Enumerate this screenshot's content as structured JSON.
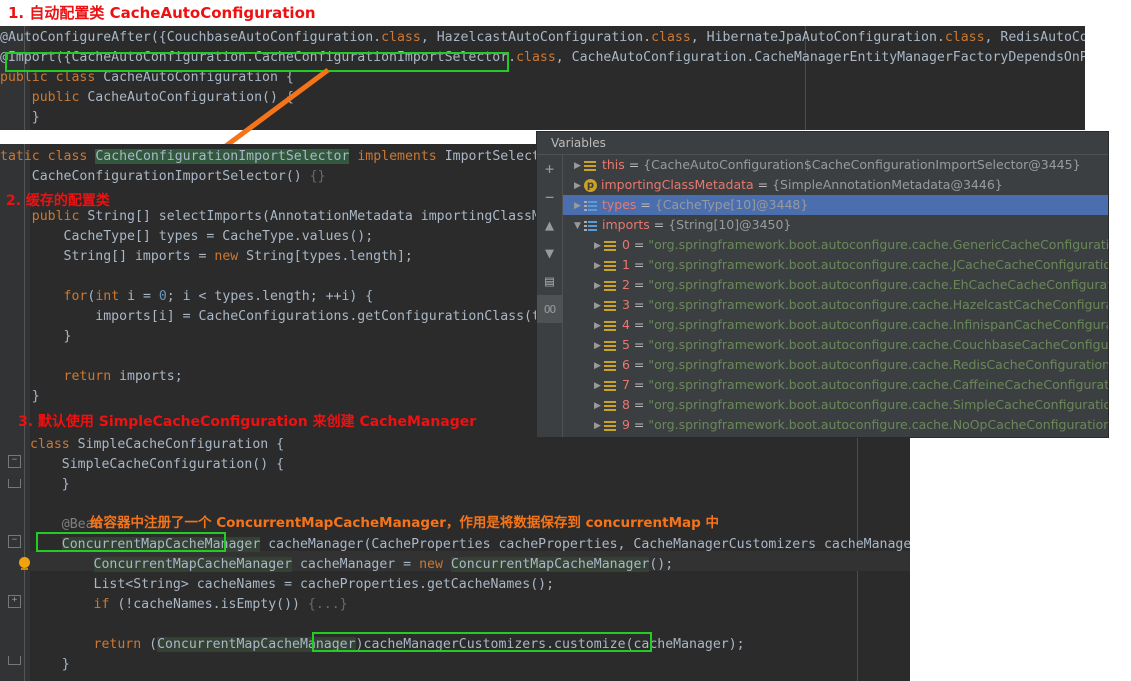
{
  "page": {
    "title_annotation": "1. 自动配置类 CacheAutoConfiguration"
  },
  "annotations": [
    {
      "id": "a1",
      "text": "1. 自动配置类 CacheAutoConfiguration",
      "color": "#ee1111"
    },
    {
      "id": "a2",
      "text": "2. 缓存的配置类",
      "color": "#ee1111"
    },
    {
      "id": "a3",
      "text": "3. 默认使用 SimpleCacheConfiguration 来创建 CacheManager",
      "color": "#ee1111"
    },
    {
      "id": "a4",
      "text": "给容器中注册了一个 ConcurrentMapCacheManager，作用是将数据保存到 concurrentMap 中",
      "color": "#f5741a"
    }
  ],
  "editor_top": {
    "lines": [
      {
        "parts": [
          {
            "t": "@AutoConfigureAfter({CouchbaseAutoConfiguration.",
            "c": "plain"
          },
          {
            "t": "class",
            "c": "kw"
          },
          {
            "t": ", HazelcastAutoConfiguration.",
            "c": "plain"
          },
          {
            "t": "class",
            "c": "kw"
          },
          {
            "t": ", HibernateJpaAutoConfiguration.",
            "c": "plain"
          },
          {
            "t": "class",
            "c": "kw"
          },
          {
            "t": ", RedisAutoConfiguration.cl",
            "c": "plain"
          }
        ]
      },
      {
        "parts": [
          {
            "t": "@Import({CacheAutoConfiguration.CacheConfigurationImportSelector.",
            "c": "plain"
          },
          {
            "t": "class",
            "c": "kw"
          },
          {
            "t": ", CacheAutoConfiguration.CacheManagerEntityManagerFactoryDependsOnPostProcessor.c",
            "c": "plain"
          }
        ]
      },
      {
        "parts": [
          {
            "t": "public",
            "c": "kw"
          },
          {
            "t": " ",
            "c": "plain"
          },
          {
            "t": "class",
            "c": "kw"
          },
          {
            "t": " CacheAutoConfiguration {",
            "c": "plain"
          }
        ]
      },
      {
        "parts": [
          {
            "t": "    ",
            "c": "plain"
          },
          {
            "t": "public",
            "c": "kw"
          },
          {
            "t": " CacheAutoConfiguration() {",
            "c": "plain"
          }
        ]
      },
      {
        "parts": [
          {
            "t": "    }",
            "c": "plain"
          }
        ]
      }
    ]
  },
  "editor_mid": {
    "lines": [
      {
        "parts": [
          {
            "t": "tatic",
            "c": "kw"
          },
          {
            "t": " ",
            "c": "plain"
          },
          {
            "t": "class",
            "c": "kw"
          },
          {
            "t": " ",
            "c": "plain"
          },
          {
            "t": "CacheConfigurationImportSelector",
            "c": "sel"
          },
          {
            "t": " ",
            "c": "plain"
          },
          {
            "t": "implements",
            "c": "kw"
          },
          {
            "t": " ImportSelector {",
            "c": "plain"
          }
        ]
      },
      {
        "parts": [
          {
            "t": "    CacheConfigurationImportSelector() ",
            "c": "plain"
          },
          {
            "t": "{}",
            "c": "grey"
          }
        ]
      },
      {
        "parts": [
          {
            "t": "",
            "c": "plain"
          }
        ]
      },
      {
        "parts": [
          {
            "t": "    ",
            "c": "plain"
          },
          {
            "t": "public",
            "c": "kw"
          },
          {
            "t": " String[] selectImports(AnnotationMetadata importingClassMetadata)",
            "c": "plain"
          }
        ]
      },
      {
        "parts": [
          {
            "t": "        CacheType[] types = CacheType.values();",
            "c": "plain"
          }
        ]
      },
      {
        "parts": [
          {
            "t": "        String[] imports = ",
            "c": "plain"
          },
          {
            "t": "new",
            "c": "kw"
          },
          {
            "t": " String[types.length];",
            "c": "plain"
          }
        ]
      },
      {
        "parts": [
          {
            "t": "",
            "c": "plain"
          }
        ]
      },
      {
        "parts": [
          {
            "t": "        ",
            "c": "plain"
          },
          {
            "t": "for",
            "c": "kw"
          },
          {
            "t": "(",
            "c": "plain"
          },
          {
            "t": "int",
            "c": "kw"
          },
          {
            "t": " i = ",
            "c": "plain"
          },
          {
            "t": "0",
            "c": "num"
          },
          {
            "t": "; i < types.length; ++i) {",
            "c": "plain"
          }
        ]
      },
      {
        "parts": [
          {
            "t": "            imports[i] = CacheConfigurations.getConfigurationClass(types[i]);",
            "c": "plain"
          }
        ]
      },
      {
        "parts": [
          {
            "t": "        }",
            "c": "plain"
          }
        ]
      },
      {
        "parts": [
          {
            "t": "",
            "c": "plain"
          }
        ]
      },
      {
        "parts": [
          {
            "t": "        ",
            "c": "plain"
          },
          {
            "t": "return",
            "c": "kw"
          },
          {
            "t": " imports;",
            "c": "plain"
          }
        ]
      },
      {
        "parts": [
          {
            "t": "    }",
            "c": "plain"
          }
        ]
      }
    ]
  },
  "editor_bottom": {
    "lines": [
      {
        "parts": [
          {
            "t": "class",
            "c": "kw"
          },
          {
            "t": " SimpleCacheConfiguration {",
            "c": "plain"
          }
        ]
      },
      {
        "parts": [
          {
            "t": "    SimpleCacheConfiguration() {",
            "c": "plain"
          }
        ]
      },
      {
        "parts": [
          {
            "t": "    }",
            "c": "plain"
          }
        ]
      },
      {
        "parts": [
          {
            "t": "",
            "c": "plain"
          }
        ]
      },
      {
        "parts": [
          {
            "t": "    ",
            "c": "plain"
          },
          {
            "t": "@Bean",
            "c": "cmt"
          }
        ]
      },
      {
        "parts": [
          {
            "t": "    ",
            "c": "plain"
          },
          {
            "t": "ConcurrentMapCacheManager",
            "c": "selm"
          },
          {
            "t": " cacheManager(CacheProperties cacheProperties, CacheManagerCustomizers cacheManagerCustomizers) {",
            "c": "plain"
          }
        ]
      },
      {
        "parts": [
          {
            "t": "        ",
            "c": "plain"
          },
          {
            "t": "ConcurrentMapCacheManager",
            "c": "selm"
          },
          {
            "t": " cacheManager = ",
            "c": "plain"
          },
          {
            "t": "new",
            "c": "kw"
          },
          {
            "t": " ",
            "c": "plain"
          },
          {
            "t": "ConcurrentMapCacheManager",
            "c": "selm"
          },
          {
            "t": "();",
            "c": "plain"
          }
        ]
      },
      {
        "parts": [
          {
            "t": "        List<String> cacheNames = cacheProperties.getCacheNames();",
            "c": "plain"
          }
        ]
      },
      {
        "parts": [
          {
            "t": "        ",
            "c": "plain"
          },
          {
            "t": "if",
            "c": "kw"
          },
          {
            "t": " (!cacheNames.isEmpty()) ",
            "c": "plain"
          },
          {
            "t": "{...}",
            "c": "grey"
          }
        ]
      },
      {
        "parts": [
          {
            "t": "",
            "c": "plain"
          }
        ]
      },
      {
        "parts": [
          {
            "t": "        ",
            "c": "plain"
          },
          {
            "t": "return",
            "c": "kw"
          },
          {
            "t": " (",
            "c": "plain"
          },
          {
            "t": "ConcurrentMapCacheManager",
            "c": "selm"
          },
          {
            "t": ")cacheManagerCustomizers.customize(cacheManager);",
            "c": "plain"
          }
        ]
      },
      {
        "parts": [
          {
            "t": "    }",
            "c": "plain"
          }
        ]
      }
    ]
  },
  "variables_panel": {
    "header": "Variables",
    "toolbar": [
      {
        "name": "add-watch-button",
        "glyph": "+"
      },
      {
        "name": "remove-watch-button",
        "glyph": "−"
      },
      {
        "name": "move-up-button",
        "glyph": "▲"
      },
      {
        "name": "move-down-button",
        "glyph": "▼"
      },
      {
        "name": "copy-value-button",
        "glyph": "▤"
      },
      {
        "name": "watches-toggle-button",
        "glyph": "OO"
      }
    ],
    "rows": [
      {
        "indent": 0,
        "tri": "▶",
        "icon": "array",
        "name": "this",
        "eq": " = ",
        "value": "{CacheAutoConfiguration$CacheConfigurationImportSelector@3445}",
        "value_kind": "obj",
        "selected": false
      },
      {
        "indent": 0,
        "tri": "▶",
        "icon": "param",
        "name": "importingClassMetadata",
        "eq": " = ",
        "value": "{SimpleAnnotationMetadata@3446}",
        "value_kind": "obj",
        "selected": false
      },
      {
        "indent": 0,
        "tri": "▶",
        "icon": "list",
        "name": "types",
        "eq": " = ",
        "value": "{CacheType[10]@3448}",
        "value_kind": "obj",
        "selected": true
      },
      {
        "indent": 0,
        "tri": "▼",
        "icon": "list",
        "name": "imports",
        "eq": " = ",
        "value": "{String[10]@3450}",
        "value_kind": "obj",
        "selected": false
      },
      {
        "indent": 1,
        "tri": "▶",
        "icon": "array",
        "name": "0",
        "eq": " = ",
        "value": "\"org.springframework.boot.autoconfigure.cache.GenericCacheConfiguration\"",
        "value_kind": "str",
        "selected": false
      },
      {
        "indent": 1,
        "tri": "▶",
        "icon": "array",
        "name": "1",
        "eq": " = ",
        "value": "\"org.springframework.boot.autoconfigure.cache.JCacheCacheConfiguration\"",
        "value_kind": "str",
        "selected": false
      },
      {
        "indent": 1,
        "tri": "▶",
        "icon": "array",
        "name": "2",
        "eq": " = ",
        "value": "\"org.springframework.boot.autoconfigure.cache.EhCacheCacheConfiguration\"",
        "value_kind": "str",
        "selected": false
      },
      {
        "indent": 1,
        "tri": "▶",
        "icon": "array",
        "name": "3",
        "eq": " = ",
        "value": "\"org.springframework.boot.autoconfigure.cache.HazelcastCacheConfiguration\"",
        "value_kind": "str",
        "selected": false
      },
      {
        "indent": 1,
        "tri": "▶",
        "icon": "array",
        "name": "4",
        "eq": " = ",
        "value": "\"org.springframework.boot.autoconfigure.cache.InfinispanCacheConfiguration\"",
        "value_kind": "str",
        "selected": false
      },
      {
        "indent": 1,
        "tri": "▶",
        "icon": "array",
        "name": "5",
        "eq": " = ",
        "value": "\"org.springframework.boot.autoconfigure.cache.CouchbaseCacheConfiguration\"",
        "value_kind": "str",
        "selected": false
      },
      {
        "indent": 1,
        "tri": "▶",
        "icon": "array",
        "name": "6",
        "eq": " = ",
        "value": "\"org.springframework.boot.autoconfigure.cache.RedisCacheConfiguration\"",
        "value_kind": "str",
        "selected": false
      },
      {
        "indent": 1,
        "tri": "▶",
        "icon": "array",
        "name": "7",
        "eq": " = ",
        "value": "\"org.springframework.boot.autoconfigure.cache.CaffeineCacheConfiguration\"",
        "value_kind": "str",
        "selected": false
      },
      {
        "indent": 1,
        "tri": "▶",
        "icon": "array",
        "name": "8",
        "eq": " = ",
        "value": "\"org.springframework.boot.autoconfigure.cache.SimpleCacheConfiguration\"",
        "value_kind": "str",
        "selected": false
      },
      {
        "indent": 1,
        "tri": "▶",
        "icon": "array",
        "name": "9",
        "eq": " = ",
        "value": "\"org.springframework.boot.autoconfigure.cache.NoOpCacheConfiguration\"",
        "value_kind": "str",
        "selected": false
      }
    ]
  },
  "colors": {
    "editor_bg": "#2b2b2b",
    "panel_bg": "#3c3f41",
    "selection_blue": "#4b6eaf",
    "highlight_green": "#22cc22",
    "annotation_red": "#ee1111",
    "annotation_orange": "#f5741a",
    "string_green": "#6a8759",
    "keyword_orange": "#cc7832"
  }
}
